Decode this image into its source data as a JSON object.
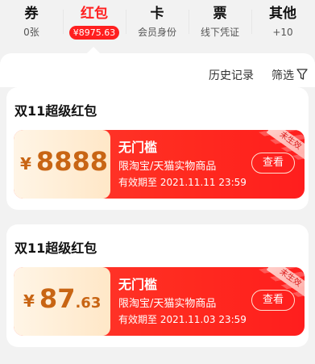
{
  "tabs": [
    {
      "title": "券",
      "sub": "0张"
    },
    {
      "title": "红包",
      "sub": "¥8975.63"
    },
    {
      "title": "卡",
      "sub": "会员身份"
    },
    {
      "title": "票",
      "sub": "线下凭证"
    },
    {
      "title": "其他",
      "sub": "+10"
    }
  ],
  "toolbar": {
    "history": "历史记录",
    "filter": "筛选"
  },
  "cards": [
    {
      "title": "双11超级红包",
      "currency": "¥",
      "amount_int": "8888",
      "amount_dec": "",
      "heading": "无门槛",
      "scope": "限淘宝/天猫实物商品",
      "validity": "有效期至 2021.11.11 23:59",
      "button": "查看",
      "status": "未生效"
    },
    {
      "title": "双11超级红包",
      "currency": "¥",
      "amount_int": "87",
      "amount_dec": ".63",
      "heading": "无门槛",
      "scope": "限淘宝/天猫实物商品",
      "validity": "有效期至 2021.11.03 23:59",
      "button": "查看",
      "status": "未生效"
    }
  ],
  "colors": {
    "accent": "#ff1f1f",
    "amount": "#c86514"
  }
}
